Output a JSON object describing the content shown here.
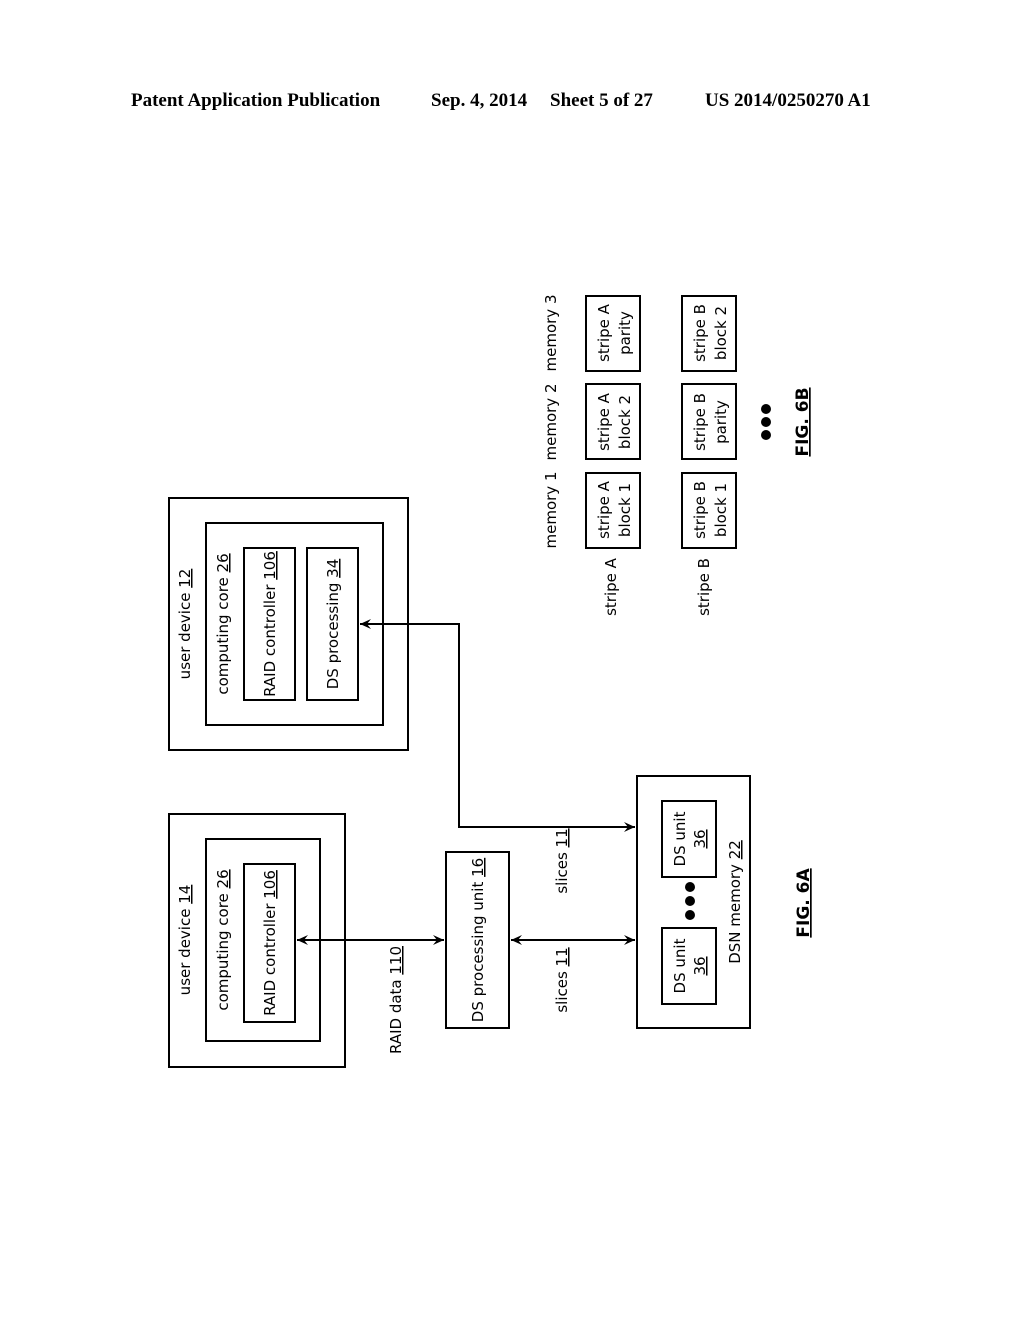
{
  "header": {
    "publication": "Patent Application Publication",
    "date": "Sep. 4, 2014",
    "sheet": "Sheet 5 of 27",
    "number": "US 2014/0250270 A1"
  },
  "fig6a": {
    "caption": "FIG. 6A",
    "user_device_12": {
      "label": "user device ",
      "ref": "12"
    },
    "user_device_14": {
      "label": "user device ",
      "ref": "14"
    },
    "computing_core": {
      "label": "computing core ",
      "ref": "26"
    },
    "raid_controller": {
      "label": "RAID controller ",
      "ref": "106"
    },
    "ds_processing": {
      "label": "DS processing ",
      "ref": "34"
    },
    "ds_processing_unit": {
      "label": "DS processing unit ",
      "ref": "16"
    },
    "raid_data": {
      "label": "RAID data ",
      "ref": "110"
    },
    "slices": {
      "label": "slices ",
      "ref": "11"
    },
    "dsn_memory": {
      "label": "DSN memory ",
      "ref": "22"
    },
    "ds_unit": {
      "label": "DS unit",
      "ref": "36"
    }
  },
  "fig6b": {
    "caption": "FIG. 6B",
    "memories": [
      "memory 1",
      "memory 2",
      "memory 3"
    ],
    "stripes": [
      "stripe A",
      "stripe B"
    ],
    "cells": [
      [
        [
          "stripe A",
          "block 1"
        ],
        [
          "stripe A",
          "block 2"
        ],
        [
          "stripe A",
          "parity"
        ]
      ],
      [
        [
          "stripe B",
          "block 1"
        ],
        [
          "stripe B",
          "parity"
        ],
        [
          "stripe B",
          "block 2"
        ]
      ]
    ]
  }
}
